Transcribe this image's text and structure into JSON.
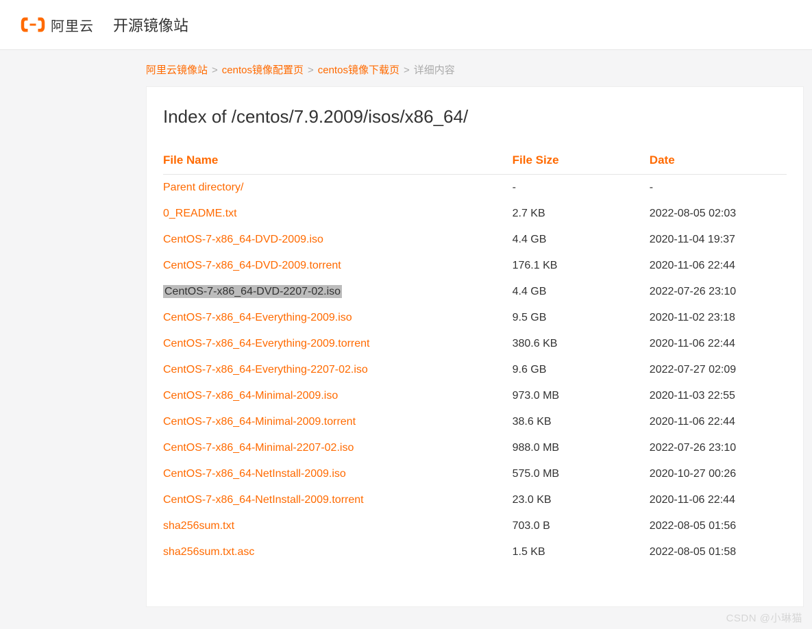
{
  "header": {
    "logo_text": "阿里云",
    "site_title": "开源镜像站"
  },
  "breadcrumb": {
    "items": [
      {
        "label": "阿里云镜像站",
        "link": true
      },
      {
        "label": "centos镜像配置页",
        "link": true
      },
      {
        "label": "centos镜像下载页",
        "link": true
      },
      {
        "label": "详细内容",
        "link": false
      }
    ],
    "sep": ">"
  },
  "page": {
    "title": "Index of /centos/7.9.2009/isos/x86_64/"
  },
  "table": {
    "headers": {
      "name": "File Name",
      "size": "File Size",
      "date": "Date"
    },
    "rows": [
      {
        "name": "Parent directory/",
        "size": "-",
        "date": "-",
        "selected": false
      },
      {
        "name": "0_README.txt",
        "size": "2.7 KB",
        "date": "2022-08-05 02:03",
        "selected": false
      },
      {
        "name": "CentOS-7-x86_64-DVD-2009.iso",
        "size": "4.4 GB",
        "date": "2020-11-04 19:37",
        "selected": false
      },
      {
        "name": "CentOS-7-x86_64-DVD-2009.torrent",
        "size": "176.1 KB",
        "date": "2020-11-06 22:44",
        "selected": false
      },
      {
        "name": "CentOS-7-x86_64-DVD-2207-02.iso",
        "size": "4.4 GB",
        "date": "2022-07-26 23:10",
        "selected": true
      },
      {
        "name": "CentOS-7-x86_64-Everything-2009.iso",
        "size": "9.5 GB",
        "date": "2020-11-02 23:18",
        "selected": false
      },
      {
        "name": "CentOS-7-x86_64-Everything-2009.torrent",
        "size": "380.6 KB",
        "date": "2020-11-06 22:44",
        "selected": false
      },
      {
        "name": "CentOS-7-x86_64-Everything-2207-02.iso",
        "size": "9.6 GB",
        "date": "2022-07-27 02:09",
        "selected": false
      },
      {
        "name": "CentOS-7-x86_64-Minimal-2009.iso",
        "size": "973.0 MB",
        "date": "2020-11-03 22:55",
        "selected": false
      },
      {
        "name": "CentOS-7-x86_64-Minimal-2009.torrent",
        "size": "38.6 KB",
        "date": "2020-11-06 22:44",
        "selected": false
      },
      {
        "name": "CentOS-7-x86_64-Minimal-2207-02.iso",
        "size": "988.0 MB",
        "date": "2022-07-26 23:10",
        "selected": false
      },
      {
        "name": "CentOS-7-x86_64-NetInstall-2009.iso",
        "size": "575.0 MB",
        "date": "2020-10-27 00:26",
        "selected": false
      },
      {
        "name": "CentOS-7-x86_64-NetInstall-2009.torrent",
        "size": "23.0 KB",
        "date": "2020-11-06 22:44",
        "selected": false
      },
      {
        "name": "sha256sum.txt",
        "size": "703.0 B",
        "date": "2022-08-05 01:56",
        "selected": false
      },
      {
        "name": "sha256sum.txt.asc",
        "size": "1.5 KB",
        "date": "2022-08-05 01:58",
        "selected": false
      }
    ]
  },
  "watermark": "CSDN @小琳猫"
}
